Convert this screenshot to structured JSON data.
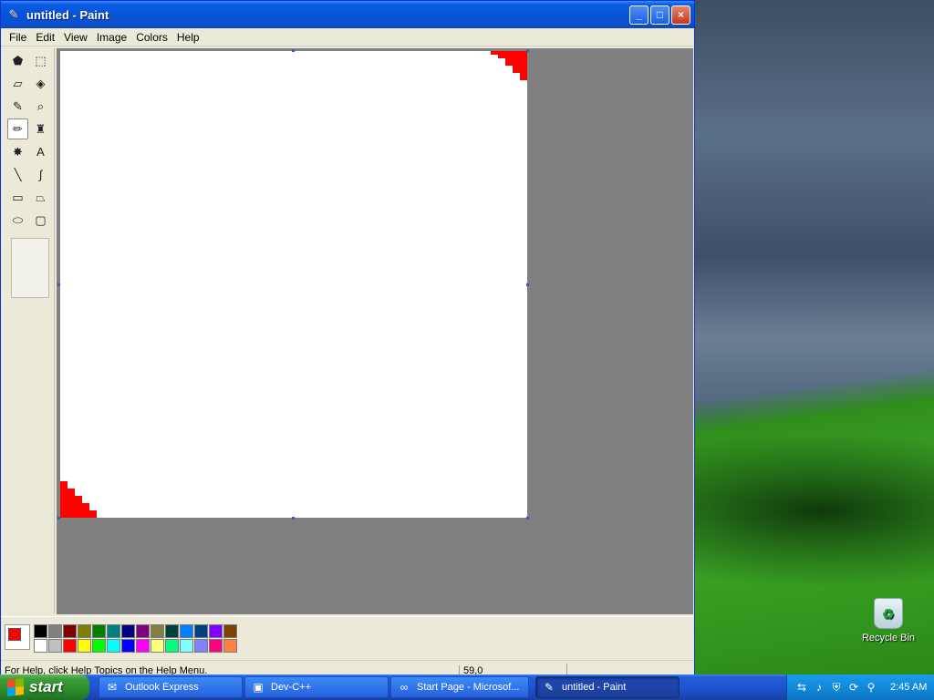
{
  "window": {
    "title": "untitled - Paint",
    "buttons": {
      "minimize": "_",
      "maximize": "□",
      "close": "×"
    }
  },
  "menu": [
    "File",
    "Edit",
    "View",
    "Image",
    "Colors",
    "Help"
  ],
  "tools": [
    {
      "name": "free-form-select",
      "glyph": "⬟"
    },
    {
      "name": "select",
      "glyph": "⬚"
    },
    {
      "name": "eraser",
      "glyph": "▱"
    },
    {
      "name": "fill",
      "glyph": "◈"
    },
    {
      "name": "pick-color",
      "glyph": "✎"
    },
    {
      "name": "magnifier",
      "glyph": "⌕"
    },
    {
      "name": "pencil",
      "glyph": "✏",
      "active": true
    },
    {
      "name": "brush",
      "glyph": "♜"
    },
    {
      "name": "airbrush",
      "glyph": "✸"
    },
    {
      "name": "text",
      "glyph": "A"
    },
    {
      "name": "line",
      "glyph": "╲"
    },
    {
      "name": "curve",
      "glyph": "∫"
    },
    {
      "name": "rectangle",
      "glyph": "▭"
    },
    {
      "name": "polygon",
      "glyph": "⏢"
    },
    {
      "name": "ellipse",
      "glyph": "⬭"
    },
    {
      "name": "rounded-rectangle",
      "glyph": "▢"
    }
  ],
  "palette": {
    "foreground": "#ff0000",
    "background": "#ffffff",
    "top_row": [
      "#000000",
      "#808080",
      "#800000",
      "#808000",
      "#008000",
      "#008080",
      "#000080",
      "#800080",
      "#808040",
      "#004040",
      "#0080ff",
      "#004080",
      "#8000ff",
      "#804000"
    ],
    "bottom_row": [
      "#ffffff",
      "#c0c0c0",
      "#ff0000",
      "#ffff00",
      "#00ff00",
      "#00ffff",
      "#0000ff",
      "#ff00ff",
      "#ffff80",
      "#00ff80",
      "#80ffff",
      "#8080ff",
      "#ff0080",
      "#ff8040"
    ]
  },
  "status": {
    "help": "For Help, click Help Topics on the Help Menu.",
    "coords": "59,0"
  },
  "desktop": {
    "recycle_bin": "Recycle Bin"
  },
  "taskbar": {
    "start": "start",
    "tasks": [
      {
        "label": "Outlook Express",
        "icon": "outlook-icon",
        "glyph": "✉"
      },
      {
        "label": "Dev-C++",
        "icon": "devcpp-icon",
        "glyph": "▣"
      },
      {
        "label": "Start Page - Microsof...",
        "icon": "visual-studio-icon",
        "glyph": "∞"
      },
      {
        "label": "untitled - Paint",
        "icon": "paint-icon",
        "glyph": "✎",
        "active": true
      }
    ],
    "tray_icons": [
      "network-icon",
      "volume-icon",
      "security-icon",
      "update-icon",
      "search-icon"
    ],
    "clock": "2:45 AM"
  }
}
